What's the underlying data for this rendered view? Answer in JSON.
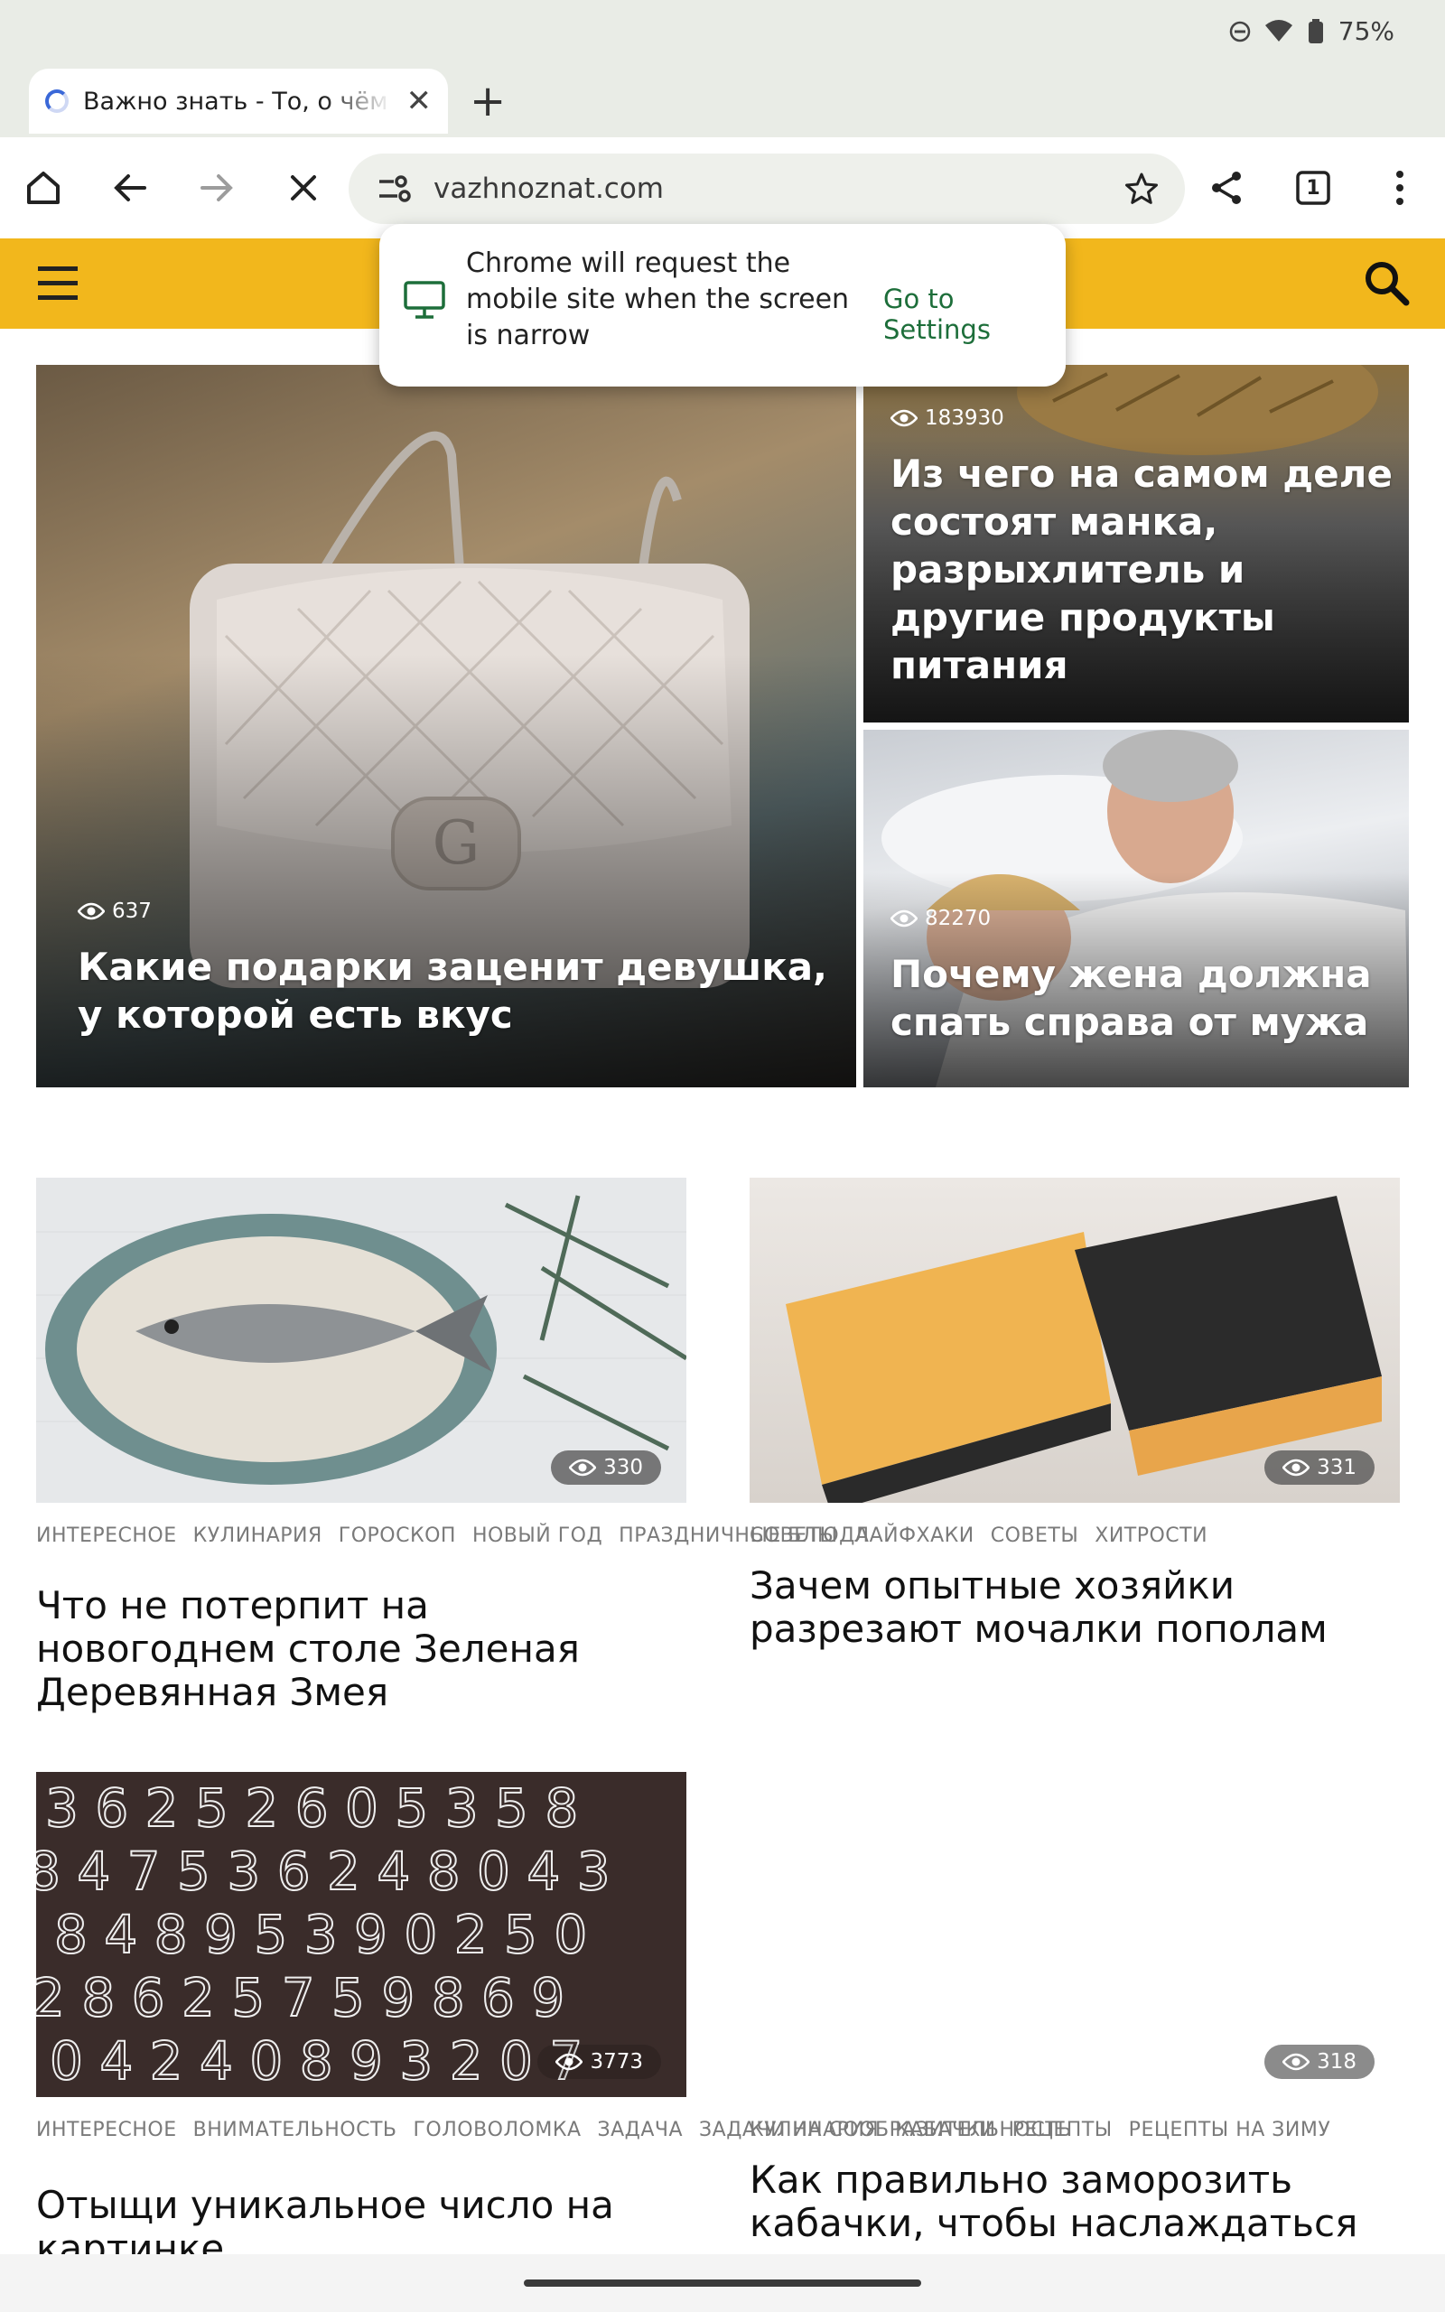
{
  "status": {
    "battery": "75%"
  },
  "tab": {
    "title": "Важно знать - То, о чём стоит знать"
  },
  "omnibox": {
    "url": "vazhnoznat.com"
  },
  "tabs_count": "1",
  "popup": {
    "text": "Chrome will request the mobile site when the screen is narrow",
    "link": "Go to Settings"
  },
  "featured": {
    "main": {
      "views": "637",
      "title": "Какие подарки заценит девушка, у которой есть вкус"
    },
    "top_right": {
      "views": "183930",
      "title": "Из чего на самом деле состоят манка, разрыхлитель и другие продукты питания"
    },
    "bottom_right": {
      "views": "82270",
      "title": "Почему жена должна спать справа от мужа"
    }
  },
  "posts": [
    {
      "views": "330",
      "tags": [
        "ИНТЕРЕСНОЕ",
        "КУЛИНАРИЯ",
        "ГОРОСКОП",
        "НОВЫЙ ГОД",
        "ПРАЗДНИЧНЫЕ БЛЮДА"
      ],
      "title": "Что не потерпит на новогоднем столе Зеленая Деревянная Змея"
    },
    {
      "views": "331",
      "tags": [
        "СОВЕТЫ",
        "ЛАЙФХАКИ",
        "СОВЕТЫ",
        "ХИТРОСТИ"
      ],
      "title": "Зачем опытные хозяйки разрезают мочалки пополам"
    },
    {
      "views": "3773",
      "tags": [
        "ИНТЕРЕСНОЕ",
        "ВНИМАТЕЛЬНОСТЬ",
        "ГОЛОВОЛОМКА",
        "ЗАДАЧА",
        "ЗАДАЧИ НА СООБРАЗИТЕЛЬНОСТЬ"
      ],
      "title": "Отыщи уникальное число на картинке"
    },
    {
      "views": "318",
      "tags": [
        "КУЛИНАРИЯ",
        "КАБАЧКИ",
        "РЕЦЕПТЫ",
        "РЕЦЕПТЫ НА ЗИМУ"
      ],
      "title": "Как правильно заморозить кабачки, чтобы наслаждаться ими всю зиму"
    }
  ],
  "colors": {
    "header": "#f2b71c",
    "link": "#1d6e3a"
  }
}
